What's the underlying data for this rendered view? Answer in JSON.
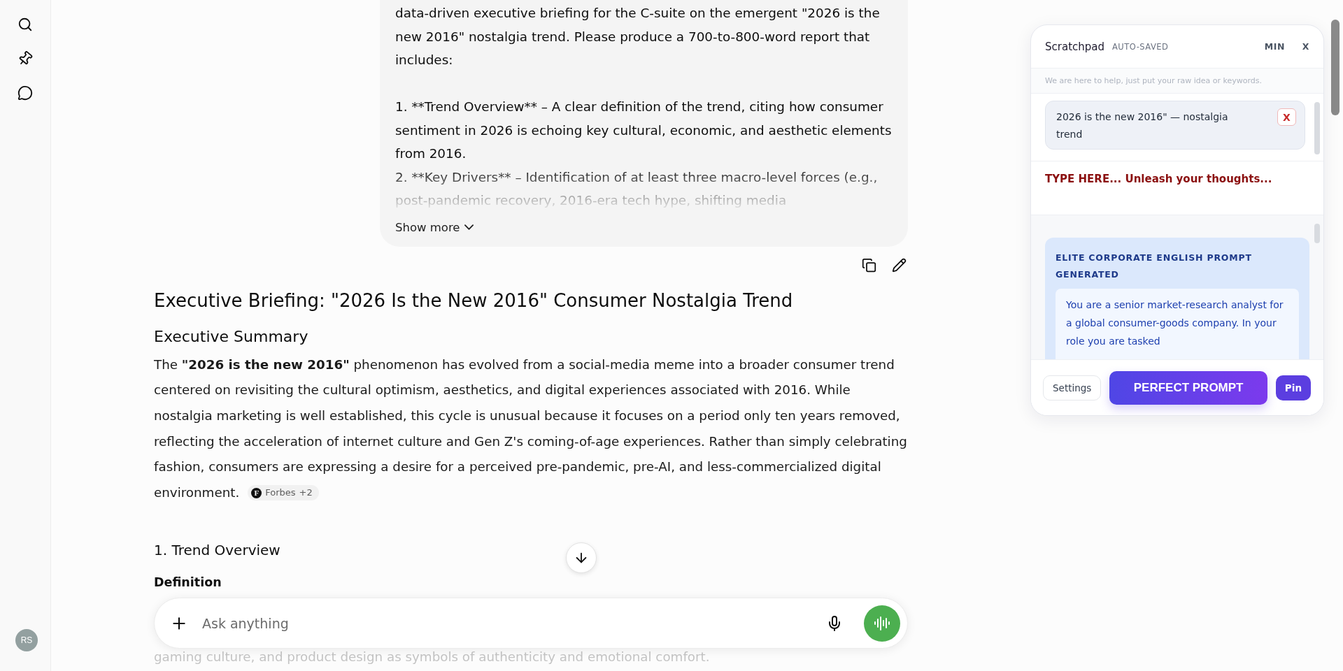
{
  "sidebar": {
    "avatar": "RS"
  },
  "user_message": {
    "paragraphs": [
      "data-driven executive briefing for the C-suite on the emergent \"2026 is the new 2016\" nostalgia trend. Please produce a 700-to-800-word report that includes:",
      "1. **Trend Overview** – A clear definition of the trend, citing how consumer sentiment in 2026 is echoing key cultural, economic, and aesthetic elements from 2016.",
      "2. **Key Drivers** – Identification of at least three macro-level forces (e.g., post-pandemic recovery, 2016-era tech hype, shifting media"
    ],
    "show_more": "Show more"
  },
  "response": {
    "title": "Executive Briefing: \"2026 Is the New 2016\" Consumer Nostalgia Trend",
    "section": "Executive Summary",
    "paragraph": "The **\"2026 is the new 2016\"** phenomenon has evolved from a social-media meme into a broader consumer trend centered on revisiting the cultural optimism, aesthetics, and digital experiences associated with 2016. While nostalgia marketing is well established, this cycle is unusual because it focuses on a period only ten years removed, reflecting the acceleration of internet culture and Gen Z's coming-of-age experiences. Rather than simply celebrating fashion, consumers are expressing a desire for a perceived pre-pandemic, pre-AI, and less-commercialized digital environment.",
    "citation": {
      "icon": "F",
      "source": "Forbes",
      "more": "+2"
    },
    "subsection": "1. Trend Overview",
    "subheading": "Definition",
    "trailing_line": "gaming culture, and product design as symbols of authenticity and emotional comfort."
  },
  "composer": {
    "placeholder": "Ask anything"
  },
  "scratchpad": {
    "title": "Scratchpad",
    "status": "AUTO-SAVED",
    "min": "MIN",
    "close": "X",
    "hint": "We are here to help, just put your raw idea or keywords.",
    "chips": [
      {
        "text": "2026 is the new 2016\" — nostalgia trend",
        "remove": "X"
      }
    ],
    "input_placeholder": "TYPE HERE... Unleash your thoughts...",
    "result": {
      "label": "ELITE CORPORATE ENGLISH PROMPT GENERATED",
      "text": "You are a senior market-research analyst for a global consumer-goods company. In your role you are tasked"
    },
    "buttons": {
      "settings": "Settings",
      "primary": "PERFECT PROMPT",
      "pin": "Pin"
    }
  }
}
